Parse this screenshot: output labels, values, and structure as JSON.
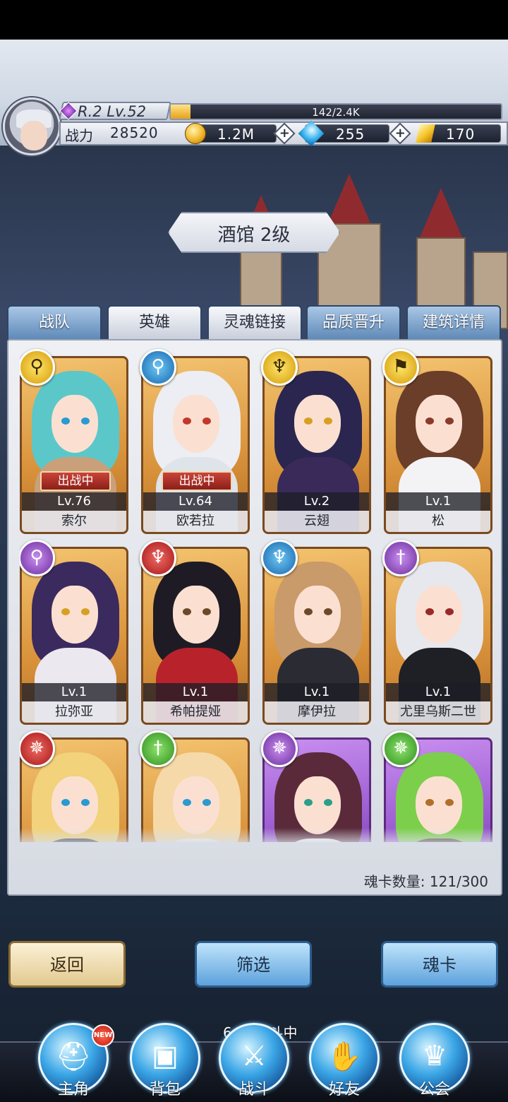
{
  "header": {
    "rank_level": "R.2 Lv.52",
    "exp_text": "142/2.4K",
    "exp_fraction": 0.06,
    "power_label": "战力",
    "power_value": "28520",
    "gold": "1.2M",
    "diamonds": "255",
    "crystals": "170"
  },
  "title": "酒馆 2级",
  "tabs": [
    {
      "label": "战队",
      "active": false
    },
    {
      "label": "英雄",
      "active": true
    },
    {
      "label": "灵魂链接",
      "active": false
    },
    {
      "label": "品质晋升",
      "active": false
    },
    {
      "label": "建筑详情",
      "active": false
    }
  ],
  "heroes": [
    {
      "name": "索尔",
      "level": "Lv.76",
      "deployed": "出战中",
      "class_icon": "orb-staff-icon",
      "class_color": "yellow",
      "hair": "#5bc7c9",
      "body": "#c9a07a",
      "eye": "#2a9ad0",
      "frame": "gold"
    },
    {
      "name": "欧若拉",
      "level": "Lv.64",
      "deployed": "出战中",
      "class_icon": "orb-staff-icon",
      "class_color": "blue",
      "hair": "#eceef3",
      "body": "#dfe3ea",
      "eye": "#c0392b",
      "frame": "gold"
    },
    {
      "name": "云翅",
      "level": "Lv.2",
      "deployed": "",
      "class_icon": "wings-icon",
      "class_color": "yellow",
      "hair": "#2a2650",
      "body": "#3a2a5a",
      "eye": "#d6a022",
      "frame": "gold"
    },
    {
      "name": "松",
      "level": "Lv.1",
      "deployed": "",
      "class_icon": "flag-icon",
      "class_color": "yellow",
      "hair": "#6b3e2a",
      "body": "#f3f3f5",
      "eye": "#8a3b2a",
      "frame": "gold"
    },
    {
      "name": "拉弥亚",
      "level": "Lv.1",
      "deployed": "",
      "class_icon": "orb-staff-icon",
      "class_color": "purple",
      "hair": "#3b2a5e",
      "body": "#ece8ef",
      "eye": "#d6a022",
      "frame": "gold"
    },
    {
      "name": "希帕提娅",
      "level": "Lv.1",
      "deployed": "",
      "class_icon": "wings-icon",
      "class_color": "red",
      "hair": "#1f1b24",
      "body": "#b8232b",
      "eye": "#6b4a2a",
      "frame": "gold"
    },
    {
      "name": "摩伊拉",
      "level": "Lv.1",
      "deployed": "",
      "class_icon": "wings-icon",
      "class_color": "blue",
      "hair": "#c99a6a",
      "body": "#2b2b33",
      "eye": "#6b4a2a",
      "frame": "gold"
    },
    {
      "name": "尤里乌斯二世",
      "level": "Lv.1",
      "deployed": "",
      "class_icon": "sword-icon",
      "class_color": "purple",
      "hair": "#e6e8ee",
      "body": "#1f1f26",
      "eye": "#9a2a2a",
      "frame": "gold"
    },
    {
      "name": "",
      "level": "",
      "deployed": "",
      "class_icon": "shuriken-icon",
      "class_color": "red",
      "hair": "#f2d27a",
      "body": "#2a2a33",
      "eye": "#2a9ad0",
      "frame": "gold"
    },
    {
      "name": "",
      "level": "",
      "deployed": "",
      "class_icon": "sword-icon",
      "class_color": "green",
      "hair": "#f5d9a8",
      "body": "#f1ede6",
      "eye": "#2a9ad0",
      "frame": "gold"
    },
    {
      "name": "",
      "level": "",
      "deployed": "",
      "class_icon": "shuriken-icon",
      "class_color": "purple",
      "hair": "#5a2a3a",
      "body": "#f3f3f5",
      "eye": "#2aa089",
      "frame": "purple"
    },
    {
      "name": "",
      "level": "",
      "deployed": "",
      "class_icon": "shuriken-icon",
      "class_color": "green",
      "hair": "#7ccf4a",
      "body": "#3a2a2a",
      "eye": "#b0702a",
      "frame": "purple"
    }
  ],
  "soul_card_count": "魂卡数量: 121/300",
  "buttons": {
    "back": "返回",
    "filter": "筛选",
    "soul_card": "魂卡"
  },
  "battle_status": "64层战斗中",
  "nav": [
    {
      "label": "主角",
      "icon": "helmet-icon",
      "badge": "NEW"
    },
    {
      "label": "背包",
      "icon": "backpack-icon",
      "badge": ""
    },
    {
      "label": "战斗",
      "icon": "crossed-swords-icon",
      "badge": ""
    },
    {
      "label": "好友",
      "icon": "handshake-icon",
      "badge": ""
    },
    {
      "label": "公会",
      "icon": "guild-crest-icon",
      "badge": ""
    }
  ]
}
